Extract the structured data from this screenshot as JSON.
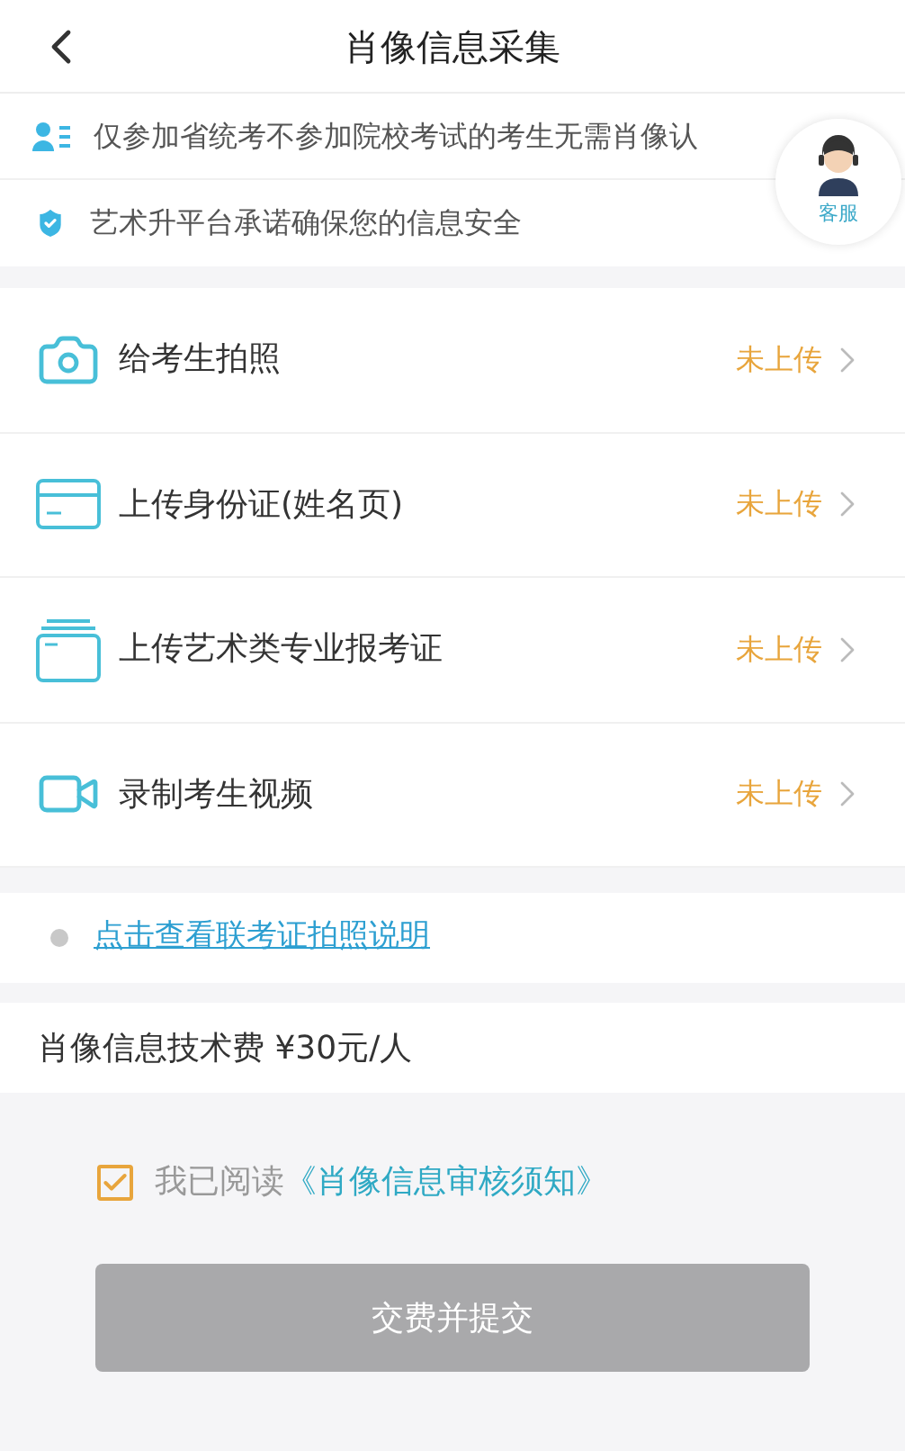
{
  "header": {
    "title": "肖像信息采集"
  },
  "notices": [
    {
      "kind": "person",
      "text": "仅参加省统考不参加院校考试的考生无需肖像认"
    },
    {
      "kind": "shield",
      "text": "艺术升平台承诺确保您的信息安全"
    }
  ],
  "support": {
    "label": "客服"
  },
  "uploads": [
    {
      "kind": "camera",
      "label": "给考生拍照",
      "status": "未上传"
    },
    {
      "kind": "idcard",
      "label": "上传身份证(姓名页)",
      "status": "未上传"
    },
    {
      "kind": "cards",
      "label": "上传艺术类专业报考证",
      "status": "未上传"
    },
    {
      "kind": "video",
      "label": "录制考生视频",
      "status": "未上传"
    }
  ],
  "guide_link": "点击查看联考证拍照说明",
  "fee": "肖像信息技术费 ¥30元/人",
  "agreement": {
    "checked": true,
    "prefix": "我已阅读",
    "link": "《肖像信息审核须知》"
  },
  "submit": {
    "label": "交费并提交",
    "disabled": true
  }
}
